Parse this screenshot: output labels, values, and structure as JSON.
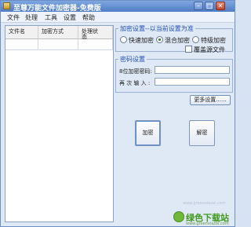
{
  "window": {
    "title": "至尊万能文件加密器-免费版"
  },
  "menu": [
    "文件",
    "处理",
    "工具",
    "设置",
    "帮助"
  ],
  "file_list": {
    "columns": [
      "文件名",
      "加密方式",
      "处理状态"
    ],
    "rows": [
      [
        "",
        "",
        ""
      ]
    ]
  },
  "encrypt_settings": {
    "legend": "加密设置--以当前设置为准",
    "modes": [
      {
        "label": "快速加密",
        "selected": false
      },
      {
        "label": "混合加密",
        "selected": true
      },
      {
        "label": "特级加密",
        "selected": false
      }
    ],
    "overwrite_label": "覆盖源文件",
    "overwrite_checked": false
  },
  "password_settings": {
    "legend": "密码设置",
    "password_label": "8位加密密码:",
    "password_value": "",
    "confirm_label": "再 次 输 入 :",
    "confirm_value": ""
  },
  "more_settings_label": "更多设置......",
  "encrypt_button": "加密",
  "decrypt_button": "解密",
  "watermark": {
    "text": "绿色下载站",
    "url": "www.greenxiazai.com"
  },
  "faint_url": "www.greenxiazai.com",
  "colors": {
    "legend_blue": "#1f4fb3",
    "titlebar": "#4f7cc4",
    "watermark_green": "#3f9a1b"
  }
}
